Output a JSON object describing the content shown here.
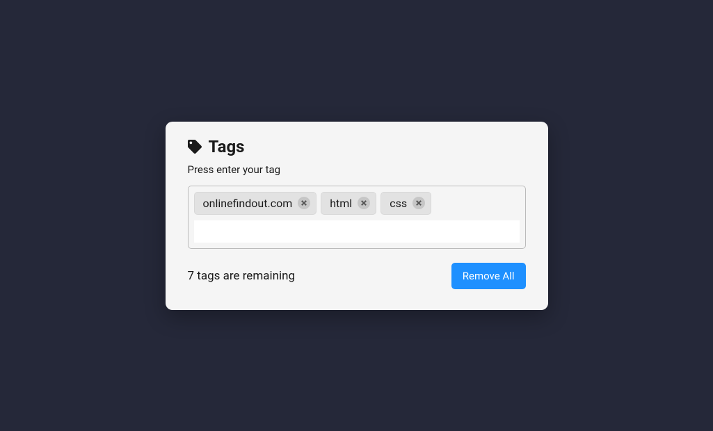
{
  "title": "Tags",
  "instruction": "Press enter your tag",
  "tags": [
    "onlinefindout.com",
    "html",
    "css"
  ],
  "remaining_text": "7 tags are remaining",
  "remove_all_label": "Remove All",
  "input_value": ""
}
